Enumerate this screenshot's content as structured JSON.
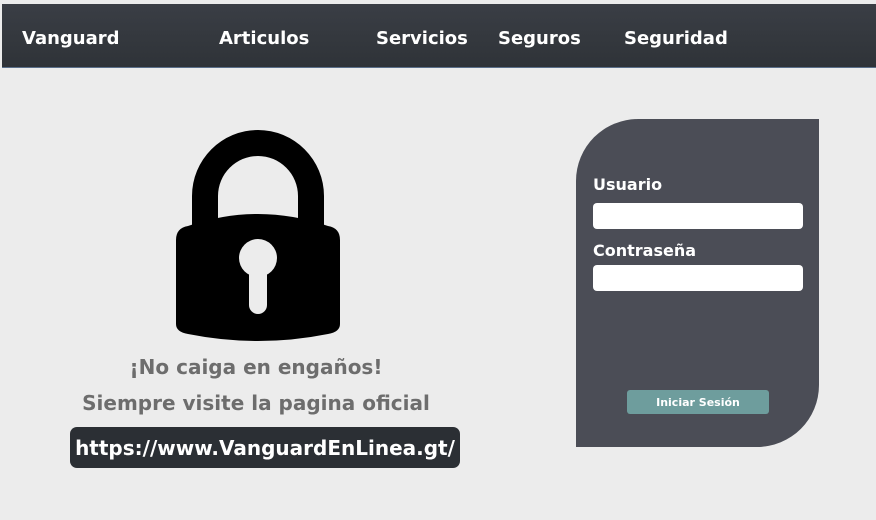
{
  "header": {
    "brand": "Vanguard",
    "nav": [
      "Articulos",
      "Servicios",
      "Seguros",
      "Seguridad"
    ]
  },
  "icons": {
    "lock": "lock-icon"
  },
  "message": {
    "line1": "¡No caiga en engaños!",
    "line2": "Siempre visite la pagina oficial",
    "url": "https://www.VanguardEnLinea.gt/"
  },
  "login": {
    "user_label": "Usuario",
    "user_value": "",
    "password_label": "Contraseña",
    "password_value": "",
    "submit_label": "Iniciar Sesión"
  },
  "colors": {
    "header": "#33373d",
    "page_bg": "#ececec",
    "panel": "#4b4d56",
    "button": "#6e9d9d",
    "url_box": "#2b2f34"
  }
}
